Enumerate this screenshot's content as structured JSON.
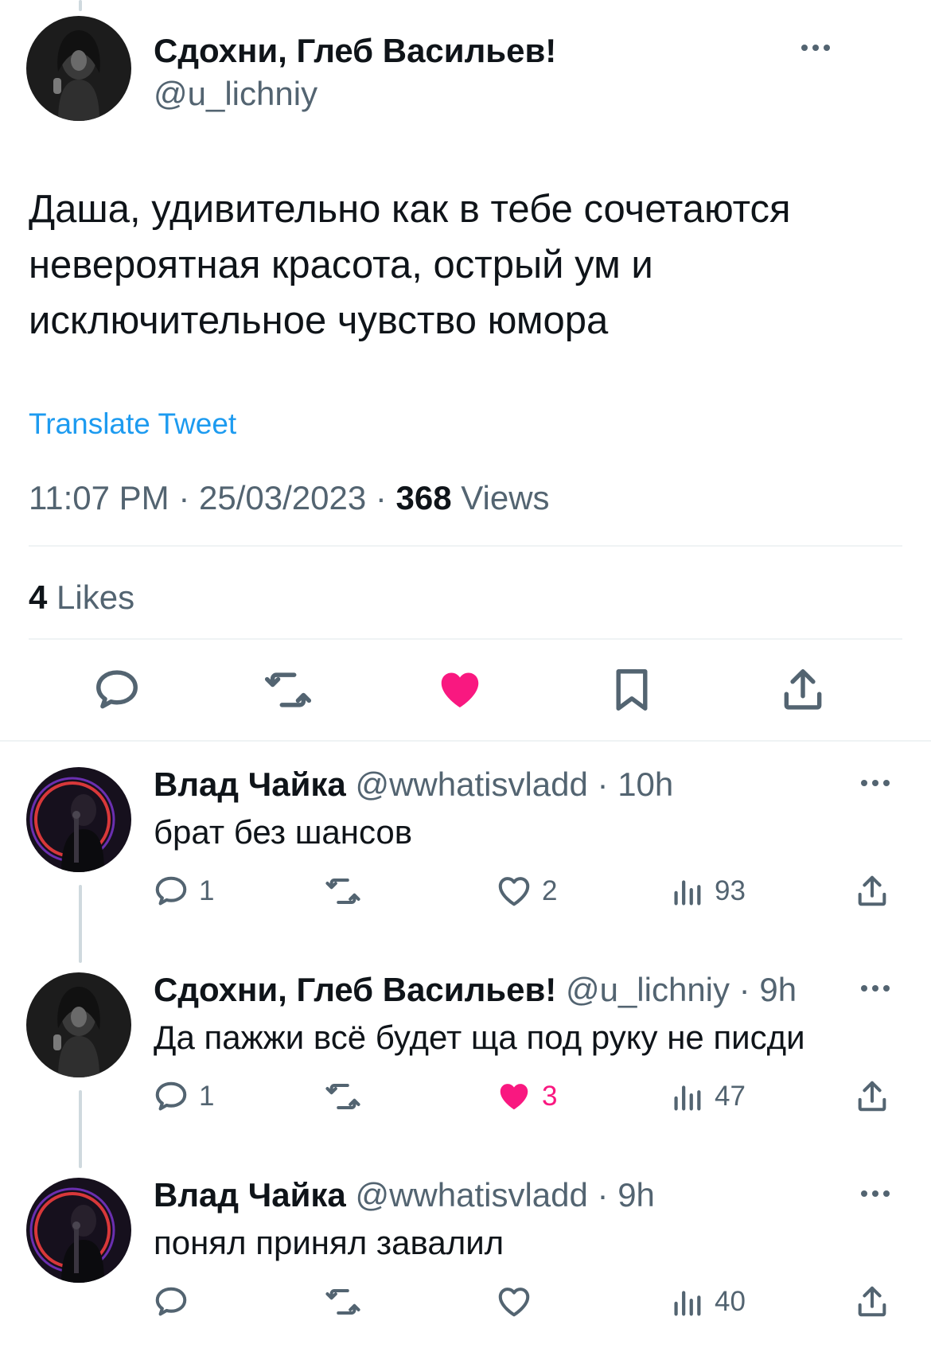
{
  "tweet": {
    "author_name": "Сдохни, Глеб Васильев!",
    "author_handle": "@u_lichniy",
    "text": "Даша, удивительно как в тебе сочетаются\nневероятная красота, острый ум и\nисключительное чувство юмора",
    "translate_label": "Translate Tweet",
    "time": "11:07 PM",
    "date": "25/03/2023",
    "views_count": "368",
    "views_label": "Views",
    "likes_count": "4",
    "likes_label": "Likes",
    "liked": true
  },
  "replies": [
    {
      "name": "Влад Чайка",
      "handle": "@wwhatisvladd",
      "age": "10h",
      "text": "брат без шансов",
      "replies": "1",
      "retweets": "",
      "likes": "2",
      "liked": false,
      "views": "93"
    },
    {
      "name": "Сдохни, Глеб Васильев!",
      "handle": "@u_lichniy",
      "age": "9h",
      "text": "Да пажжи всё будет ща под руку не писди",
      "replies": "1",
      "retweets": "",
      "likes": "3",
      "liked": true,
      "views": "47"
    },
    {
      "name": "Влад Чайка",
      "handle": "@wwhatisvladd",
      "age": "9h",
      "text": "понял принял завалил",
      "replies": "",
      "retweets": "",
      "likes": "",
      "liked": false,
      "views": "40"
    }
  ],
  "colors": {
    "accent": "#1d9bf0",
    "like": "#f91880",
    "muted": "#536471",
    "text": "#0f1419"
  },
  "icons": [
    "more-icon",
    "reply-icon",
    "retweet-icon",
    "like-icon",
    "bookmark-icon",
    "share-icon",
    "views-icon"
  ]
}
